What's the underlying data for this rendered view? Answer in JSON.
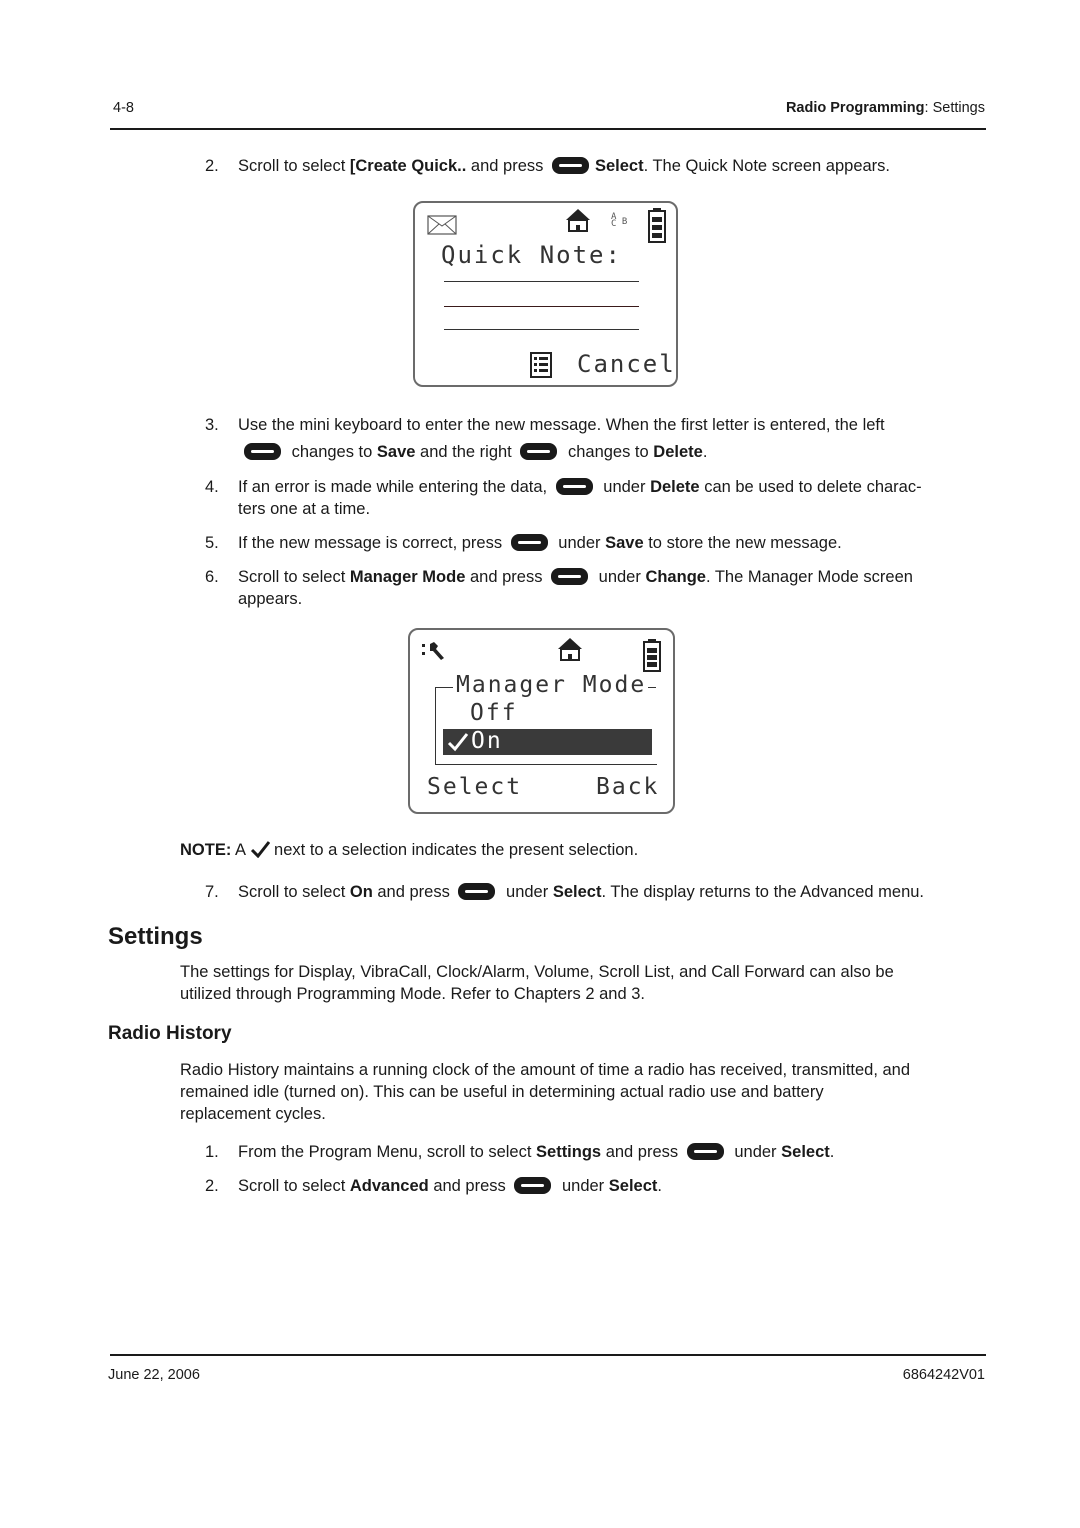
{
  "header": {
    "page_number": "4-8",
    "chapter_bold": "Radio Programming",
    "chapter_sep": ": ",
    "section": "Settings"
  },
  "steps_a": [
    {
      "num": "2.",
      "parts": [
        "Scroll to select ",
        "[Create Quick..",
        " and press ",
        "Select",
        ". The Quick Note screen appears."
      ]
    }
  ],
  "quick_note_screen": {
    "title": "Quick Note:",
    "softkey_right": "Cancel",
    "abc": [
      "A",
      "B",
      "C"
    ]
  },
  "steps_b": {
    "s3": {
      "num": "3.",
      "line1": "Use the mini keyboard to enter the new message. When the first letter is entered, the left",
      "a": "changes to ",
      "save": "Save",
      "b": " and the right",
      "c": "changes to ",
      "delete": "Delete",
      "d": "."
    },
    "s4": {
      "num": "4.",
      "a": "If an error is made while entering the data,",
      "b": "under ",
      "delete": "Delete",
      "c": " can be used to delete charac-",
      "line2": "ters one at a time."
    },
    "s5": {
      "num": "5.",
      "a": "If the new message is correct, press",
      "b": "under ",
      "save": "Save",
      "c": " to store the new message."
    },
    "s6": {
      "num": "6.",
      "a": "Scroll to select ",
      "mm": "Manager Mode",
      "b": " and press",
      "c": "under ",
      "change": "Change",
      "d": ". The Manager Mode screen",
      "line2": "appears."
    }
  },
  "manager_mode_screen": {
    "title": "Manager Mode",
    "options": [
      "Off",
      "On"
    ],
    "selected": "On",
    "softkey_left": "Select",
    "softkey_right": "Back"
  },
  "note": {
    "label": "NOTE:",
    "a": "A",
    "b": "next to a selection indicates the present selection."
  },
  "step7": {
    "num": "7.",
    "a": "Scroll to select ",
    "on": "On",
    "b": " and press",
    "c": "under ",
    "select": "Select",
    "d": ". The display returns to the Advanced menu."
  },
  "settings": {
    "heading": "Settings",
    "body_line1": "The settings for Display, VibraCall, Clock/Alarm, Volume, Scroll List, and Call Forward can also be",
    "body_line2": "utilized through Programming Mode. Refer to Chapters 2 and 3."
  },
  "radio_history": {
    "heading": "Radio History",
    "body": [
      "Radio History maintains a running clock of the amount of time a radio has received, transmitted, and",
      "remained idle (turned on). This can be useful in determining actual radio use and battery",
      "replacement cycles."
    ],
    "s1": {
      "num": "1.",
      "a": "From the Program Menu, scroll to select ",
      "settings": "Settings",
      "b": " and press",
      "c": "under ",
      "select": "Select",
      "d": "."
    },
    "s2": {
      "num": "2.",
      "a": "Scroll to select ",
      "adv": "Advanced",
      "b": " and press",
      "c": "under ",
      "select": "Select",
      "d": "."
    }
  },
  "footer": {
    "date": "June 22, 2006",
    "doc_number": "6864242V01"
  }
}
